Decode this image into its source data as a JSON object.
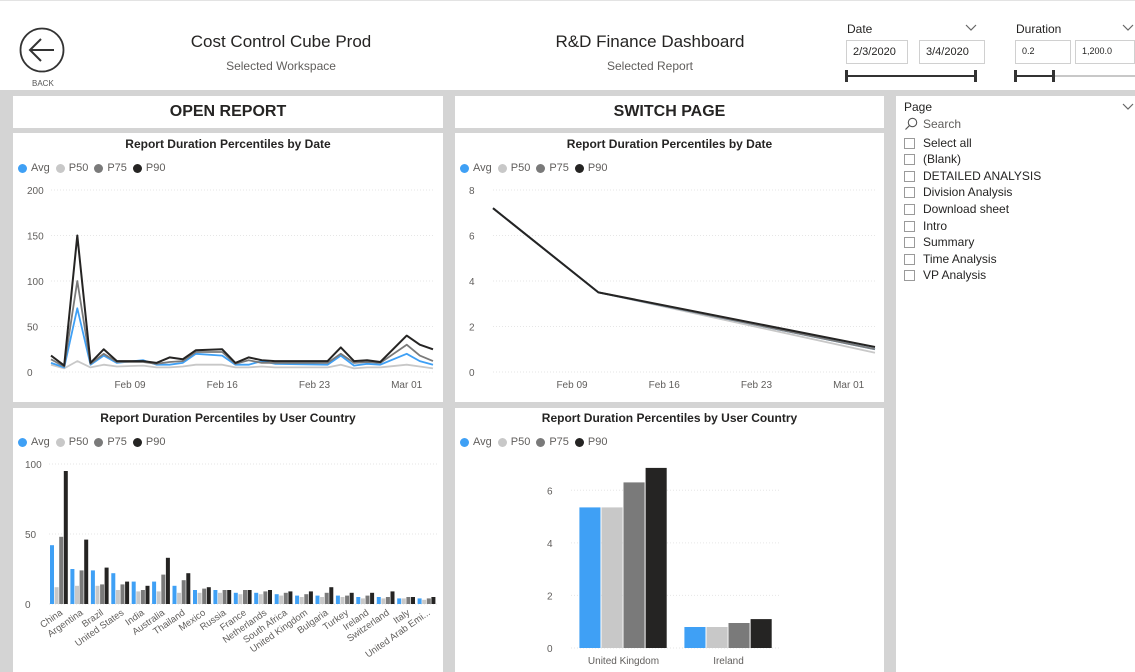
{
  "header": {
    "back_label": "BACK",
    "workspace_title": "Cost Control Cube Prod",
    "workspace_sub": "Selected Workspace",
    "report_title": "R&D Finance Dashboard",
    "report_sub": "Selected Report"
  },
  "date_slicer": {
    "label": "Date",
    "start": "2/3/2020",
    "end": "3/4/2020"
  },
  "duration_slicer": {
    "label": "Duration",
    "min": "0.2",
    "max": "1,200.0"
  },
  "buttons": {
    "open_report": "OPEN REPORT",
    "switch_page": "SWITCH PAGE"
  },
  "page_slicer": {
    "label": "Page",
    "search_placeholder": "Search",
    "items": [
      "Select all",
      "(Blank)",
      "DETAILED ANALYSIS",
      "Division Analysis",
      "Download sheet",
      "Intro",
      "Summary",
      "Time Analysis",
      "VP Analysis"
    ]
  },
  "colors": {
    "avg": "#3fa0f5",
    "p50": "#c8c8c8",
    "p75": "#7a7a7a",
    "p90": "#252423"
  },
  "legend": [
    "Avg",
    "P50",
    "P75",
    "P90"
  ],
  "chart_data": [
    {
      "type": "line",
      "title": "Report Duration Percentiles by Date",
      "x_tick_labels": [
        "Feb 09",
        "Feb 16",
        "Feb 23",
        "Mar 01"
      ],
      "y_ticks": [
        0,
        50,
        100,
        150,
        200
      ],
      "ylim": [
        0,
        200
      ],
      "x": [
        "2020-02-03",
        "2020-02-04",
        "2020-02-05",
        "2020-02-06",
        "2020-02-07",
        "2020-02-08",
        "2020-02-10",
        "2020-02-11",
        "2020-02-12",
        "2020-02-13",
        "2020-02-14",
        "2020-02-16",
        "2020-02-17",
        "2020-02-18",
        "2020-02-19",
        "2020-02-20",
        "2020-02-24",
        "2020-02-25",
        "2020-02-26",
        "2020-02-27",
        "2020-02-28",
        "2020-03-01",
        "2020-03-02",
        "2020-03-03"
      ],
      "series": [
        {
          "name": "Avg",
          "values": [
            10,
            5,
            70,
            8,
            18,
            10,
            13,
            8,
            8,
            10,
            20,
            18,
            8,
            8,
            12,
            9,
            8,
            18,
            7,
            9,
            8,
            20,
            12,
            8
          ]
        },
        {
          "name": "P50",
          "values": [
            8,
            4,
            12,
            5,
            8,
            6,
            7,
            5,
            5,
            6,
            8,
            8,
            5,
            5,
            6,
            5,
            5,
            8,
            4,
            5,
            5,
            8,
            6,
            4
          ]
        },
        {
          "name": "P75",
          "values": [
            14,
            6,
            100,
            9,
            20,
            11,
            11,
            9,
            11,
            12,
            22,
            22,
            9,
            13,
            10,
            10,
            10,
            20,
            10,
            11,
            10,
            30,
            18,
            12
          ]
        },
        {
          "name": "P90",
          "values": [
            18,
            7,
            150,
            10,
            25,
            12,
            12,
            10,
            16,
            14,
            24,
            25,
            10,
            16,
            13,
            12,
            12,
            27,
            12,
            13,
            11,
            40,
            30,
            25
          ]
        }
      ]
    },
    {
      "type": "line",
      "title": "Report Duration Percentiles by Date",
      "x_tick_labels": [
        "Feb 09",
        "Feb 16",
        "Feb 23",
        "Mar 01"
      ],
      "y_ticks": [
        0,
        2,
        4,
        6,
        8
      ],
      "ylim": [
        0,
        8
      ],
      "x": [
        "2020-02-03",
        "2020-02-11",
        "2020-03-03"
      ],
      "series": [
        {
          "name": "Avg",
          "values": [
            7.2,
            3.5,
            1.0
          ]
        },
        {
          "name": "P50",
          "values": [
            7.2,
            3.5,
            0.85
          ]
        },
        {
          "name": "P75",
          "values": [
            7.2,
            3.5,
            1.0
          ]
        },
        {
          "name": "P90",
          "values": [
            7.2,
            3.5,
            1.1
          ]
        }
      ]
    },
    {
      "type": "bar",
      "title": "Report Duration Percentiles by User Country",
      "categories": [
        "China",
        "Argentina",
        "Brazil",
        "United States",
        "India",
        "Australia",
        "Thailand",
        "Mexico",
        "Russia",
        "France",
        "Netherlands",
        "South Africa",
        "United Kingdom",
        "Bulgaria",
        "Turkey",
        "Ireland",
        "Switzerland",
        "Italy",
        "United Arab Emi..."
      ],
      "y_ticks": [
        0,
        50,
        100
      ],
      "ylim": [
        0,
        100
      ],
      "series": [
        {
          "name": "Avg",
          "values": [
            42,
            25,
            24,
            22,
            16,
            16,
            13,
            10,
            10,
            8,
            8,
            7,
            6,
            6,
            6,
            5,
            5,
            4,
            4
          ]
        },
        {
          "name": "P50",
          "values": [
            12,
            13,
            13,
            10,
            9,
            9,
            8,
            8,
            8,
            7,
            7,
            6,
            5,
            5,
            5,
            4,
            4,
            4,
            3
          ]
        },
        {
          "name": "P75",
          "values": [
            48,
            24,
            14,
            14,
            10,
            21,
            17,
            11,
            10,
            10,
            9,
            8,
            7,
            8,
            6,
            6,
            5,
            5,
            4
          ]
        },
        {
          "name": "P90",
          "values": [
            95,
            46,
            26,
            16,
            13,
            33,
            22,
            12,
            10,
            10,
            10,
            9,
            9,
            12,
            8,
            8,
            9,
            5,
            5
          ]
        }
      ]
    },
    {
      "type": "bar",
      "title": "Report Duration Percentiles by User Country",
      "categories": [
        "United Kingdom",
        "Ireland"
      ],
      "y_ticks": [
        0,
        2,
        4,
        6
      ],
      "ylim": [
        0,
        7
      ],
      "series": [
        {
          "name": "Avg",
          "values": [
            5.35,
            0.8
          ]
        },
        {
          "name": "P50",
          "values": [
            5.35,
            0.8
          ]
        },
        {
          "name": "P75",
          "values": [
            6.3,
            0.95
          ]
        },
        {
          "name": "P90",
          "values": [
            6.85,
            1.1
          ]
        }
      ]
    }
  ]
}
